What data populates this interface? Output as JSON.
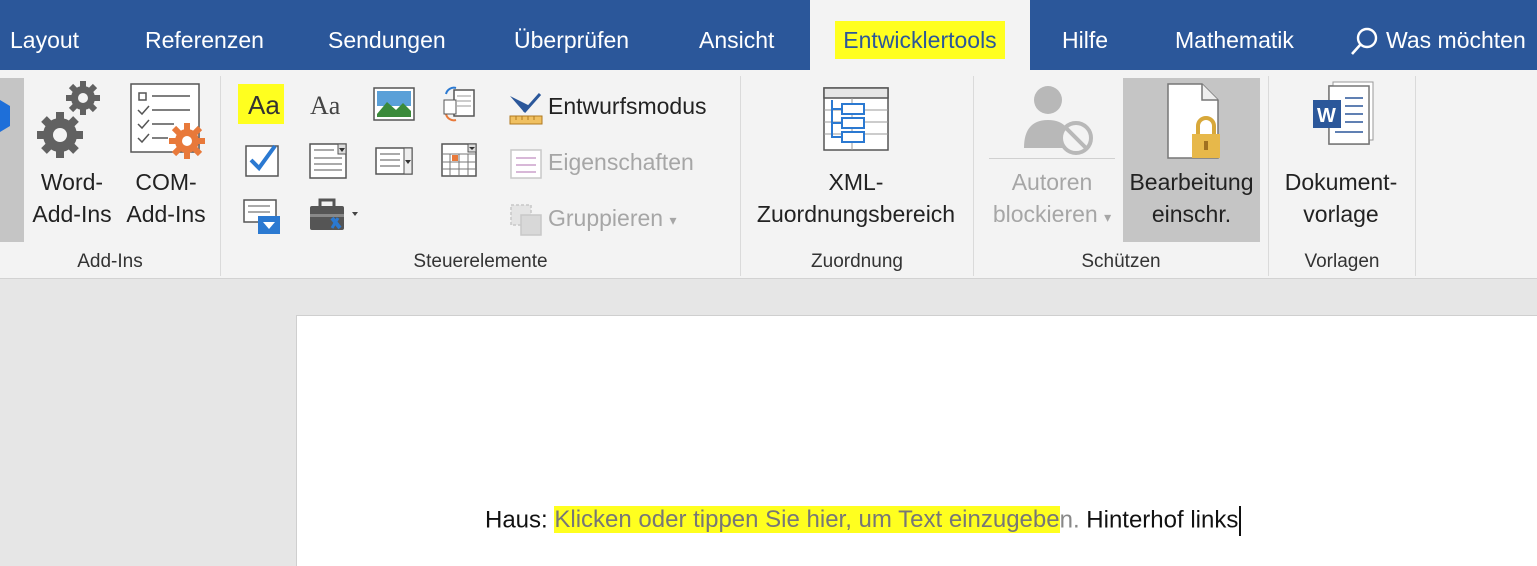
{
  "tabs": [
    {
      "label": "Layout"
    },
    {
      "label": "Referenzen"
    },
    {
      "label": "Sendungen"
    },
    {
      "label": "Überprüfen"
    },
    {
      "label": "Ansicht"
    },
    {
      "label": "Entwicklertools",
      "active": true
    },
    {
      "label": "Hilfe"
    },
    {
      "label": "Mathematik"
    }
  ],
  "tell_me": {
    "label": "Was möchten"
  },
  "groups": {
    "addins": {
      "label": "Add-Ins",
      "word_addins": {
        "line1": "Word-",
        "line2": "Add-Ins"
      },
      "com_addins": {
        "line1": "COM-",
        "line2": "Add-Ins"
      }
    },
    "controls": {
      "label": "Steuerelemente",
      "design_mode": "Entwurfsmodus",
      "properties": "Eigenschaften",
      "group": "Gruppieren"
    },
    "mapping": {
      "label": "Zuordnung",
      "xml_pane": {
        "line1": "XML-",
        "line2": "Zuordnungsbereich"
      }
    },
    "protect": {
      "label": "Schützen",
      "block_authors": {
        "line1": "Autoren",
        "line2": "blockieren"
      },
      "restrict_editing": {
        "line1": "Bearbeitung",
        "line2": "einschr."
      }
    },
    "templates": {
      "label": "Vorlagen",
      "document_template": {
        "line1": "Dokument-",
        "line2": "vorlage"
      }
    }
  },
  "document": {
    "prefix": "Haus: ",
    "placeholder": "Klicken oder tippen Sie hier, um Text einzugebe",
    "placeholder_tail": "n.",
    "suffix": " Hinterhof links"
  },
  "colors": {
    "accent": "#2b579a",
    "highlight": "#ffff1f",
    "disabled": "#a6a6a6"
  }
}
